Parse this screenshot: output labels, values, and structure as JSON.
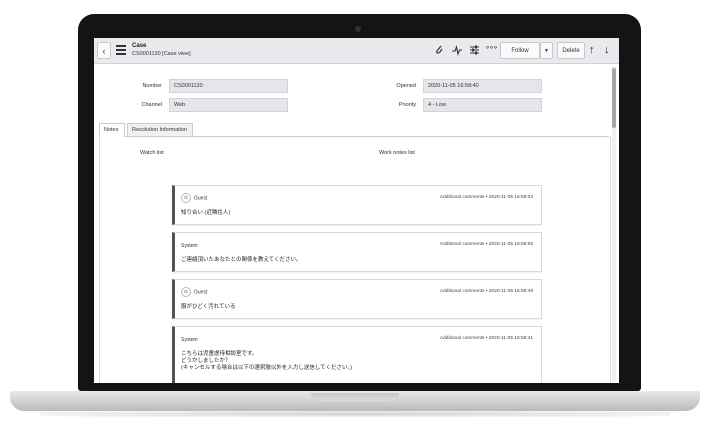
{
  "header": {
    "table_name": "Case",
    "record": "CS0001130 [Case view]",
    "follow_label": "Follow",
    "delete_label": "Delete"
  },
  "form": {
    "number_label": "Number",
    "number_value": "CS0001130",
    "channel_label": "Channel",
    "channel_value": "Web",
    "opened_label": "Opened",
    "opened_value": "2020-11-05 16:58:40",
    "priority_label": "Priority",
    "priority_value": "4 - Low"
  },
  "tabs": [
    {
      "label": "Notes"
    },
    {
      "label": "Resolution Information"
    }
  ],
  "notes": {
    "watch_list_label": "Watch list",
    "work_notes_list_label": "Work notes list"
  },
  "activity": [
    {
      "avatar": "G",
      "author": "Guest",
      "type": "Additional comments",
      "time": "2020-11-05 16:59:03",
      "lines": [
        "知り合い (近隣住人)"
      ]
    },
    {
      "avatar": "",
      "author": "System",
      "type": "Additional comments",
      "time": "2020-11-05 16:58:59",
      "lines": [
        "ご連絡頂いたあなたとの関係を教えてください。"
      ]
    },
    {
      "avatar": "G",
      "author": "Guest",
      "type": "Additional comments",
      "time": "2020-11-05 16:58:49",
      "lines": [
        "服がひどく汚れている"
      ]
    },
    {
      "avatar": "",
      "author": "System",
      "type": "Additional comments",
      "time": "2020-11-05 16:58:41",
      "lines": [
        "こちらは児童虐待相談室です。",
        "どうかしましたか？",
        "(キャンセルする場合は以下の選択肢以外を入力し送信してください。)"
      ]
    }
  ],
  "icons": {
    "back": "chevron-left-icon",
    "menu": "hamburger-menu-icon",
    "attach": "paperclip-icon",
    "activity": "activity-pulse-icon",
    "settings": "sliders-icon",
    "more": "more-horizontal-icon",
    "prev": "arrow-up-icon",
    "next": "arrow-down-icon"
  }
}
